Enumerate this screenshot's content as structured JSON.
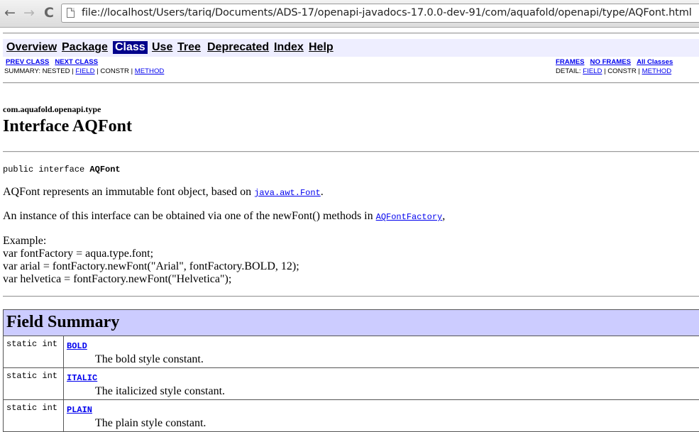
{
  "browser": {
    "url": "file://localhost/Users/tariq/Documents/ADS-17/openapi-javadocs-17.0.0-dev-91/com/aquafold/openapi/type/AQFont.html",
    "back_icon": "←",
    "forward_icon": "→",
    "reload_icon": "C"
  },
  "nav": {
    "items": [
      "Overview",
      "Package",
      "Class",
      "Use",
      "Tree",
      "Deprecated",
      "Index",
      "Help"
    ],
    "current": "Class",
    "prev_class": "PREV CLASS",
    "next_class": "NEXT CLASS",
    "frames": "FRAMES",
    "no_frames": "NO FRAMES",
    "all_classes": "All Classes",
    "summary_prefix": "SUMMARY: NESTED | ",
    "summary_field": "FIELD",
    "summary_mid": " | CONSTR | ",
    "summary_method": "METHOD",
    "detail_prefix": "DETAIL: ",
    "detail_field": "FIELD",
    "detail_mid": " | CONSTR | ",
    "detail_method": "METHOD"
  },
  "header": {
    "package": "com.aquafold.openapi.type",
    "title": "Interface AQFont"
  },
  "signature": {
    "prefix": "public interface ",
    "name": "AQFont"
  },
  "description": {
    "p1_text": "AQFont represents an immutable font object, based on ",
    "p1_link": "java.awt.Font",
    "p1_end": ".",
    "p2_text": "An instance of this interface can be obtained via one of the newFont() methods in ",
    "p2_link": "AQFontFactory",
    "p2_end": ",",
    "example_lines": [
      "Example:",
      "var fontFactory = aqua.type.font;",
      "var arial = fontFactory.newFont(\"Arial\", fontFactory.BOLD, 12);",
      "var helvetica = fontFactory.newFont(\"Helvetica\");"
    ]
  },
  "field_summary": {
    "title": "Field Summary",
    "rows": [
      {
        "type": "static int",
        "name": "BOLD",
        "desc": "The bold style constant."
      },
      {
        "type": "static int",
        "name": "ITALIC",
        "desc": "The italicized style constant."
      },
      {
        "type": "static int",
        "name": "PLAIN",
        "desc": "The plain style constant."
      }
    ]
  },
  "colors": {
    "nav_bg": "#eeeeff",
    "table_header_bg": "#ccccff",
    "current_nav_bg": "#00008b",
    "link": "#0000ee"
  }
}
